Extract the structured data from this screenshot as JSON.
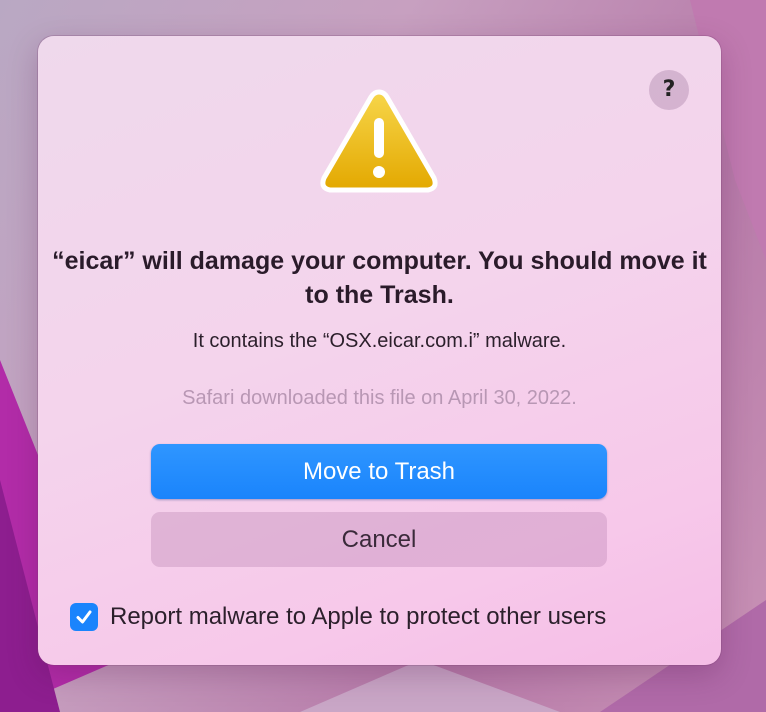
{
  "dialog": {
    "help_label": "?",
    "title": "“eicar” will damage your computer. You should move it to the Trash.",
    "subtitle": "It contains the “OSX.eicar.com.i” malware.",
    "info": "Safari downloaded this file on April 30, 2022.",
    "primary_button": "Move to Trash",
    "secondary_button": "Cancel",
    "report_checkbox": {
      "label": "Report malware to Apple to protect other users",
      "checked": true
    },
    "warning_icon": "warning-triangle-icon"
  },
  "colors": {
    "accent": "#1a84fc",
    "warning_yellow": "#f2c21a",
    "dialog_background": "#f4d4ec",
    "muted_text": "#b897b4"
  }
}
